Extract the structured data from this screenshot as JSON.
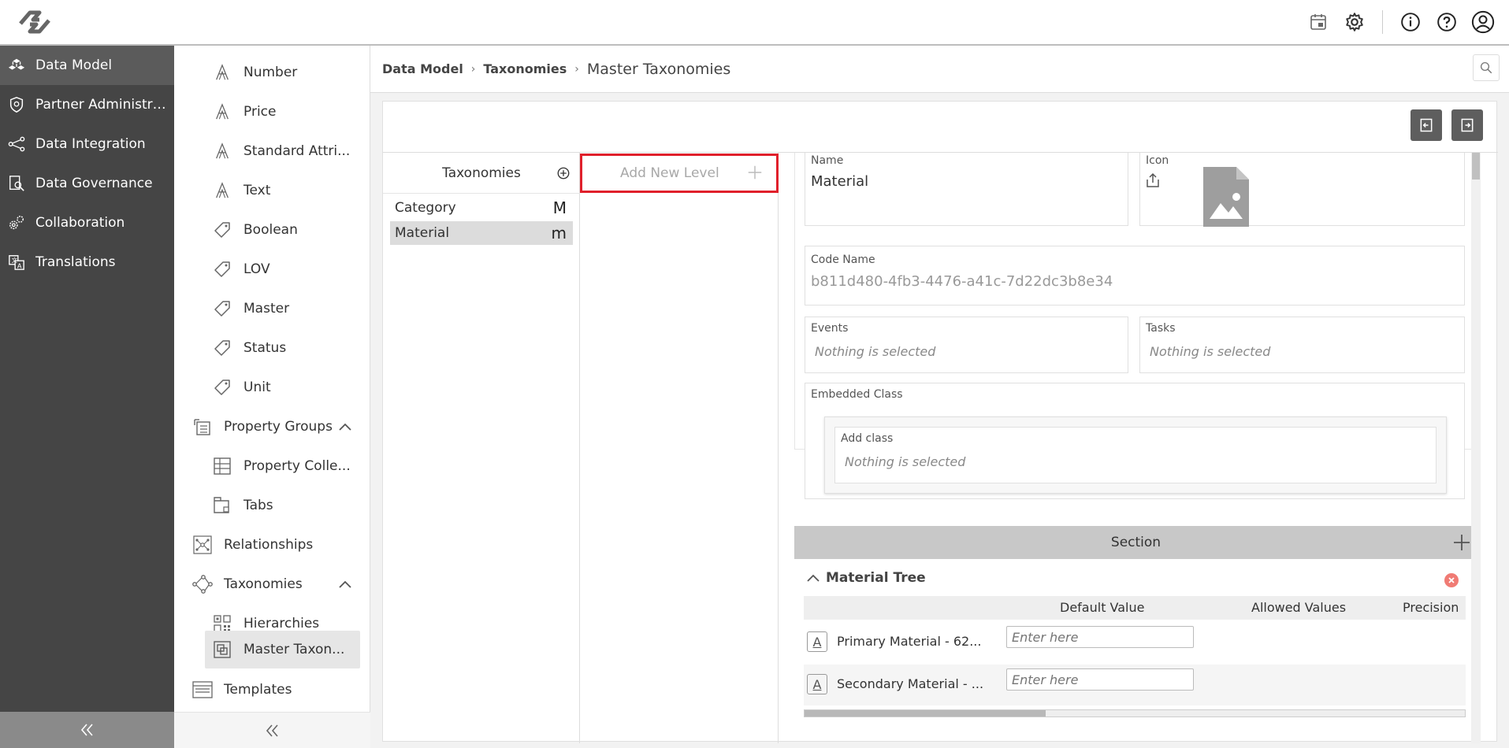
{
  "topbar": {
    "logo_icon": "app-logo-icon",
    "icons": [
      "calendar-icon",
      "gear-icon",
      "info-icon",
      "help-icon",
      "user-icon"
    ]
  },
  "leftnav": {
    "items": [
      {
        "label": "Data Model",
        "icon": "cubes-icon",
        "active": true
      },
      {
        "label": "Partner Administrati...",
        "icon": "shield-icon"
      },
      {
        "label": "Data Integration",
        "icon": "share-icon"
      },
      {
        "label": "Data Governance",
        "icon": "search-doc-icon"
      },
      {
        "label": "Collaboration",
        "icon": "gears-icon"
      },
      {
        "label": "Translations",
        "icon": "translate-icon"
      }
    ]
  },
  "subnav": {
    "items": [
      {
        "label": "Number",
        "icon": "attribute-icon"
      },
      {
        "label": "Price",
        "icon": "attribute-icon"
      },
      {
        "label": "Standard Attri...",
        "icon": "attribute-icon"
      },
      {
        "label": "Text",
        "icon": "attribute-icon"
      },
      {
        "label": "Boolean",
        "icon": "tag-icon"
      },
      {
        "label": "LOV",
        "icon": "tag-icon"
      },
      {
        "label": "Master",
        "icon": "tag-icon"
      },
      {
        "label": "Status",
        "icon": "tag-icon"
      },
      {
        "label": "Unit",
        "icon": "tag-icon"
      },
      {
        "label": "Property Groups",
        "icon": "property-groups-icon"
      },
      {
        "label": "Property Colle...",
        "icon": "grid-icon"
      },
      {
        "label": "Tabs",
        "icon": "tabs-icon"
      },
      {
        "label": "Relationships",
        "icon": "relationships-icon"
      },
      {
        "label": "Taxonomies",
        "icon": "taxonomies-icon"
      },
      {
        "label": "Hierarchies",
        "icon": "hierarchies-icon"
      },
      {
        "label": "Master Taxon...",
        "icon": "master-taxonomy-icon",
        "active": true
      },
      {
        "label": "Templates",
        "icon": "templates-icon"
      }
    ]
  },
  "breadcrumb": {
    "items": [
      "Data Model",
      "Taxonomies"
    ],
    "current": "Master Taxonomies"
  },
  "taxonomies": {
    "header": "Taxonomies",
    "rows": [
      {
        "label": "Category",
        "letter": "M"
      },
      {
        "label": "Material",
        "letter": "m",
        "selected": true
      }
    ]
  },
  "levels": {
    "add_label": "Add New Level"
  },
  "details": {
    "name_label": "Name",
    "name_value": "Material",
    "icon_label": "Icon",
    "code_label": "Code Name",
    "code_value": "b811d480-4fb3-4476-a41c-7d22dc3b8e34",
    "events_label": "Events",
    "events_value": "Nothing is selected",
    "tasks_label": "Tasks",
    "tasks_value": "Nothing is selected",
    "embedded_label": "Embedded Class",
    "add_class_label": "Add class",
    "add_class_value": "Nothing is selected"
  },
  "section": {
    "title": "Section",
    "tree_title": "Material Tree",
    "columns": [
      "Default Value",
      "Allowed Values",
      "Precision"
    ],
    "rows": [
      {
        "name": "Primary Material - 62...",
        "placeholder": "Enter here"
      },
      {
        "name": "Secondary Material - ...",
        "placeholder": "Enter here"
      }
    ]
  },
  "colors": {
    "nav_bg": "#454545",
    "nav_active": "#5b5b5b",
    "highlight_border": "#e0202b",
    "section_bar": "#c8c8c8"
  }
}
